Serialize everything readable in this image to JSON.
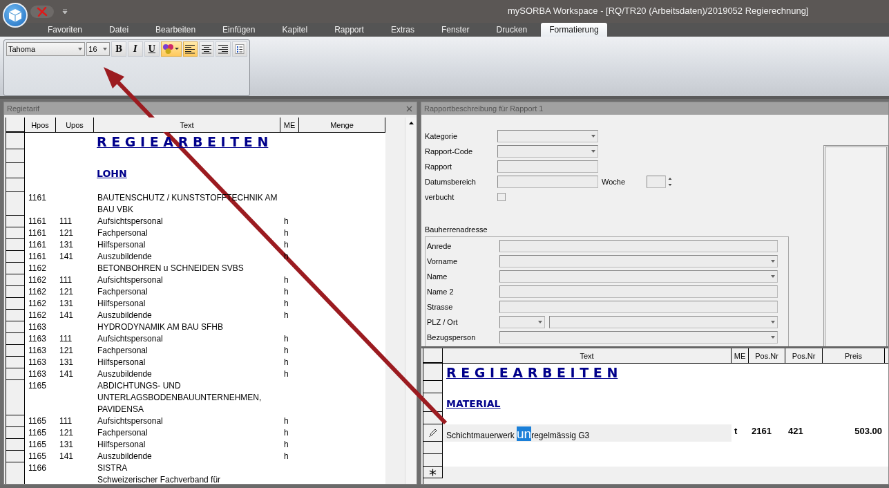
{
  "window": {
    "title": "mySORBA Workspace - [RQ/TR20 (Arbeitsdaten)/2019052 Regierechnung]"
  },
  "ribbon_tabs": [
    {
      "label": "Favoriten",
      "selected": false
    },
    {
      "label": "Datei",
      "selected": false
    },
    {
      "label": "Bearbeiten",
      "selected": false
    },
    {
      "label": "Einfügen",
      "selected": false
    },
    {
      "label": "Kapitel",
      "selected": false
    },
    {
      "label": "Rapport",
      "selected": false
    },
    {
      "label": "Extras",
      "selected": false
    },
    {
      "label": "Fenster",
      "selected": false
    },
    {
      "label": "Drucken",
      "selected": false
    },
    {
      "label": "Formatierung",
      "selected": true
    }
  ],
  "toolbar": {
    "font": "Tahoma",
    "size": "16",
    "buttons": [
      {
        "kind": "bold",
        "label": "B",
        "selected": false
      },
      {
        "kind": "italic",
        "label": "I",
        "selected": false
      },
      {
        "kind": "underline",
        "label": "U",
        "selected": false
      },
      {
        "kind": "color",
        "selected": true
      },
      {
        "kind": "align_left",
        "selected": true
      },
      {
        "kind": "align_center",
        "selected": false
      },
      {
        "kind": "align_right",
        "selected": false
      },
      {
        "kind": "list",
        "selected": false
      }
    ]
  },
  "tariff_panel": {
    "title": "Regietarif",
    "columns": [
      "Hpos",
      "Upos",
      "Text",
      "ME",
      "Menge"
    ],
    "rows": [
      {
        "kind": "heading",
        "text": "R E G I E A R B E I T E N"
      },
      {
        "kind": "spacer"
      },
      {
        "kind": "section",
        "text": "LOHN"
      },
      {
        "kind": "spacer"
      },
      {
        "kind": "item",
        "hpos": "1161",
        "text_lines": [
          "BAUTENSCHUTZ / KUNSTSTOFFTECHNIK AM",
          "BAU VBK"
        ]
      },
      {
        "kind": "item",
        "hpos": "1161",
        "upos": "111",
        "text_lines": [
          "Aufsichtspersonal"
        ],
        "me": "h"
      },
      {
        "kind": "item",
        "hpos": "1161",
        "upos": "121",
        "text_lines": [
          "Fachpersonal"
        ],
        "me": "h"
      },
      {
        "kind": "item",
        "hpos": "1161",
        "upos": "131",
        "text_lines": [
          "Hilfspersonal"
        ],
        "me": "h"
      },
      {
        "kind": "item",
        "hpos": "1161",
        "upos": "141",
        "text_lines": [
          "Auszubildende"
        ],
        "me": "h"
      },
      {
        "kind": "item",
        "hpos": "1162",
        "text_lines": [
          "BETONBOHREN u SCHNEIDEN  SVBS"
        ]
      },
      {
        "kind": "item",
        "hpos": "1162",
        "upos": "111",
        "text_lines": [
          "Aufsichtspersonal"
        ],
        "me": "h"
      },
      {
        "kind": "item",
        "hpos": "1162",
        "upos": "121",
        "text_lines": [
          "Fachpersonal"
        ],
        "me": "h"
      },
      {
        "kind": "item",
        "hpos": "1162",
        "upos": "131",
        "text_lines": [
          "Hilfspersonal"
        ],
        "me": "h"
      },
      {
        "kind": "item",
        "hpos": "1162",
        "upos": "141",
        "text_lines": [
          "Auszubildende"
        ],
        "me": "h"
      },
      {
        "kind": "item",
        "hpos": "1163",
        "text_lines": [
          "HYDRODYNAMIK AM BAU  SFHB"
        ]
      },
      {
        "kind": "item",
        "hpos": "1163",
        "upos": "111",
        "text_lines": [
          "Aufsichtspersonal"
        ],
        "me": "h"
      },
      {
        "kind": "item",
        "hpos": "1163",
        "upos": "121",
        "text_lines": [
          "Fachpersonal"
        ],
        "me": "h"
      },
      {
        "kind": "item",
        "hpos": "1163",
        "upos": "131",
        "text_lines": [
          "Hilfspersonal"
        ],
        "me": "h"
      },
      {
        "kind": "item",
        "hpos": "1163",
        "upos": "141",
        "text_lines": [
          "Auszubildende"
        ],
        "me": "h"
      },
      {
        "kind": "item",
        "hpos": "1165",
        "text_lines": [
          "ABDICHTUNGS- UND",
          "UNTERLAGSBODENBAUUNTERNEHMEN,",
          "PAVIDENSA"
        ]
      },
      {
        "kind": "item",
        "hpos": "1165",
        "upos": "111",
        "text_lines": [
          "Aufsichtspersonal"
        ],
        "me": "h"
      },
      {
        "kind": "item",
        "hpos": "1165",
        "upos": "121",
        "text_lines": [
          "Fachpersonal"
        ],
        "me": "h"
      },
      {
        "kind": "item",
        "hpos": "1165",
        "upos": "131",
        "text_lines": [
          "Hilfspersonal"
        ],
        "me": "h"
      },
      {
        "kind": "item",
        "hpos": "1165",
        "upos": "141",
        "text_lines": [
          "Auszubildende"
        ],
        "me": "h"
      },
      {
        "kind": "item",
        "hpos": "1166",
        "text_lines": [
          "SISTRA",
          "Schweizerischer Fachverband für"
        ]
      }
    ]
  },
  "report_panel": {
    "title": "Rapportbeschreibung für Rapport 1",
    "fields": [
      {
        "label": "Kategorie",
        "kind": "combo"
      },
      {
        "label": "Rapport-Code",
        "kind": "combo"
      },
      {
        "label": "Rapport",
        "kind": "text"
      },
      {
        "label": "Datumsbereich",
        "kind": "date_week",
        "extra_label": "Woche"
      },
      {
        "label": "verbucht",
        "kind": "checkbox",
        "checked": false
      }
    ],
    "address": {
      "title": "Bauherrenadresse",
      "fields": [
        {
          "label": "Anrede",
          "kind": "text"
        },
        {
          "label": "Vorname",
          "kind": "combo"
        },
        {
          "label": "Name",
          "kind": "combo"
        },
        {
          "label": "Name 2",
          "kind": "text"
        },
        {
          "label": "Strasse",
          "kind": "text"
        },
        {
          "label": "PLZ / Ort",
          "kind": "plz_ort"
        },
        {
          "label": "Bezugsperson",
          "kind": "combo"
        }
      ]
    }
  },
  "position_grid": {
    "columns": [
      "Text",
      "ME",
      "Pos.Nr",
      "Pos.Nr",
      "Preis"
    ],
    "rows": [
      {
        "kind": "heading",
        "text": "R E G I E A R B E I T E N"
      },
      {
        "kind": "spacer"
      },
      {
        "kind": "section",
        "text": "MATERIAL"
      },
      {
        "kind": "spacer"
      },
      {
        "kind": "item",
        "editing": true,
        "text_before": "Schichtmauerwerk ",
        "selection": "un",
        "text_after": "regelmässig G3",
        "me": "t",
        "pos1": "2161",
        "pos2": "421",
        "price": "503.00"
      },
      {
        "kind": "spacer"
      },
      {
        "kind": "spacer"
      },
      {
        "kind": "new"
      }
    ]
  }
}
